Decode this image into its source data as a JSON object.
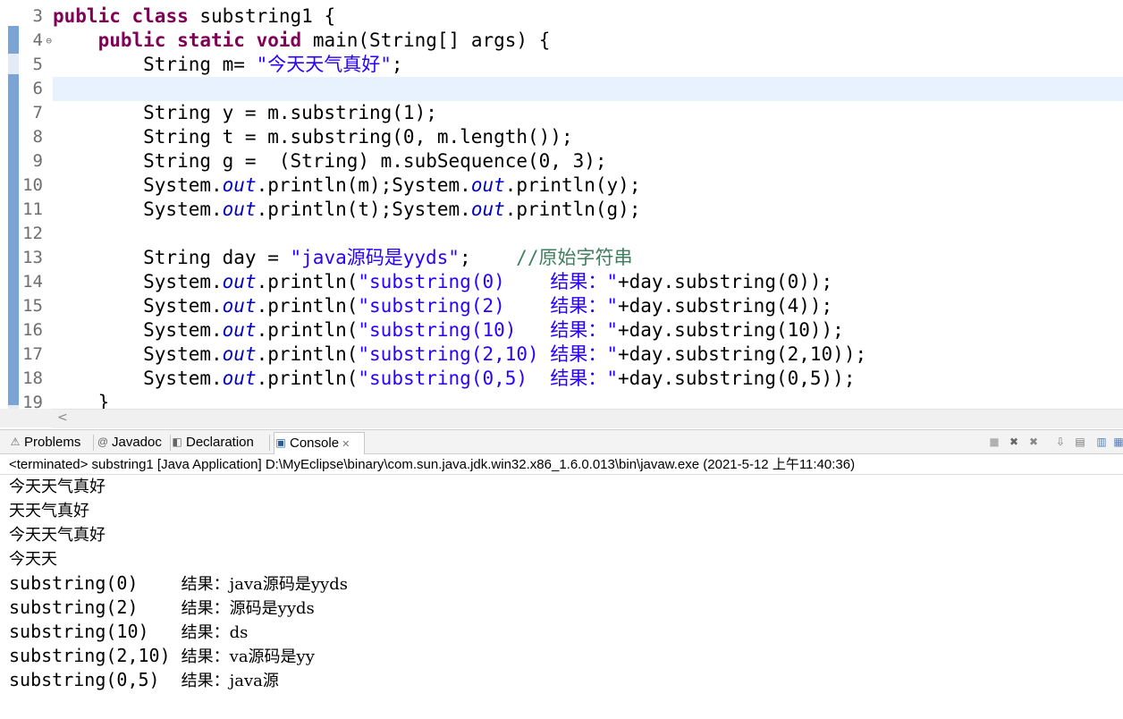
{
  "editor": {
    "line_numbers": [
      "3",
      "4",
      "5",
      "6",
      "7",
      "8",
      "9",
      "10",
      "11",
      "12",
      "13",
      "14",
      "15",
      "16",
      "17",
      "18",
      "19"
    ],
    "fold_marker": "⊖",
    "lines": [
      [
        {
          "t": "kw",
          "v": "public"
        },
        {
          "t": "p",
          "v": " "
        },
        {
          "t": "kw",
          "v": "class"
        },
        {
          "t": "p",
          "v": " substring1 {"
        }
      ],
      [
        {
          "t": "p",
          "v": "    "
        },
        {
          "t": "kw",
          "v": "public"
        },
        {
          "t": "p",
          "v": " "
        },
        {
          "t": "kw",
          "v": "static"
        },
        {
          "t": "p",
          "v": " "
        },
        {
          "t": "kw",
          "v": "void"
        },
        {
          "t": "p",
          "v": " main(String[] args) {"
        }
      ],
      [
        {
          "t": "p",
          "v": "        String m= "
        },
        {
          "t": "str",
          "v": "\"今天天气真好\""
        },
        {
          "t": "p",
          "v": ";"
        }
      ],
      [],
      [
        {
          "t": "p",
          "v": "        String y = m.substring(1);"
        }
      ],
      [
        {
          "t": "p",
          "v": "        String t = m.substring(0, m.length());"
        }
      ],
      [
        {
          "t": "p",
          "v": "        String g =  (String) m.subSequence(0, 3);"
        }
      ],
      [
        {
          "t": "p",
          "v": "        System."
        },
        {
          "t": "fld",
          "v": "out"
        },
        {
          "t": "p",
          "v": ".println(m);System."
        },
        {
          "t": "fld",
          "v": "out"
        },
        {
          "t": "p",
          "v": ".println(y);"
        }
      ],
      [
        {
          "t": "p",
          "v": "        System."
        },
        {
          "t": "fld",
          "v": "out"
        },
        {
          "t": "p",
          "v": ".println(t);System."
        },
        {
          "t": "fld",
          "v": "out"
        },
        {
          "t": "p",
          "v": ".println(g);"
        }
      ],
      [],
      [
        {
          "t": "p",
          "v": "        String day = "
        },
        {
          "t": "str",
          "v": "\"java源码是yyds\""
        },
        {
          "t": "p",
          "v": ";    "
        },
        {
          "t": "cmt",
          "v": "//原始字符串"
        }
      ],
      [
        {
          "t": "p",
          "v": "        System."
        },
        {
          "t": "fld",
          "v": "out"
        },
        {
          "t": "p",
          "v": ".println("
        },
        {
          "t": "str",
          "v": "\"substring(0)    结果：\""
        },
        {
          "t": "p",
          "v": "+day.substring(0));"
        }
      ],
      [
        {
          "t": "p",
          "v": "        System."
        },
        {
          "t": "fld",
          "v": "out"
        },
        {
          "t": "p",
          "v": ".println("
        },
        {
          "t": "str",
          "v": "\"substring(2)    结果：\""
        },
        {
          "t": "p",
          "v": "+day.substring(4));"
        }
      ],
      [
        {
          "t": "p",
          "v": "        System."
        },
        {
          "t": "fld",
          "v": "out"
        },
        {
          "t": "p",
          "v": ".println("
        },
        {
          "t": "str",
          "v": "\"substring(10)   结果：\""
        },
        {
          "t": "p",
          "v": "+day.substring(10));"
        }
      ],
      [
        {
          "t": "p",
          "v": "        System."
        },
        {
          "t": "fld",
          "v": "out"
        },
        {
          "t": "p",
          "v": ".println("
        },
        {
          "t": "str",
          "v": "\"substring(2,10) 结果：\""
        },
        {
          "t": "p",
          "v": "+day.substring(2,10));"
        }
      ],
      [
        {
          "t": "p",
          "v": "        System."
        },
        {
          "t": "fld",
          "v": "out"
        },
        {
          "t": "p",
          "v": ".println("
        },
        {
          "t": "str",
          "v": "\"substring(0,5)  结果：\""
        },
        {
          "t": "p",
          "v": "+day.substring(0,5));"
        }
      ],
      [
        {
          "t": "p",
          "v": "    }"
        }
      ]
    ],
    "current_line_index": 3,
    "scroll_left_arrow": "<"
  },
  "views": {
    "tabs": [
      {
        "label": "Problems",
        "icon": "problems-icon",
        "glyph": "⚠"
      },
      {
        "label": "Javadoc",
        "icon": "javadoc-icon",
        "glyph": "@"
      },
      {
        "label": "Declaration",
        "icon": "declaration-icon",
        "glyph": "◧"
      },
      {
        "label": "Console",
        "icon": "console-icon",
        "glyph": "▣"
      }
    ],
    "close_glyph": "✕",
    "toolbar": [
      {
        "name": "terminate-icon",
        "glyph": "■"
      },
      {
        "name": "remove-launch-icon",
        "glyph": "✖"
      },
      {
        "name": "remove-all-terminated-icon",
        "glyph": "✖"
      },
      {
        "name": "scroll-lock-icon",
        "glyph": "⇩"
      },
      {
        "name": "clear-console-icon",
        "glyph": "▤"
      },
      {
        "name": "pin-console-icon",
        "glyph": "▥"
      },
      {
        "name": "display-console-icon",
        "glyph": "▦"
      }
    ]
  },
  "console": {
    "header": "<terminated> substring1 [Java Application] D:\\MyEclipse\\binary\\com.sun.java.jdk.win32.x86_1.6.0.013\\bin\\javaw.exe (2021-5-12 上午11:40:36)",
    "output": [
      {
        "a": "",
        "b": "今天天气真好"
      },
      {
        "a": "",
        "b": "天天气真好"
      },
      {
        "a": "",
        "b": "今天天气真好"
      },
      {
        "a": "",
        "b": "今天天"
      },
      {
        "a": "substring(0)    ",
        "b": "结果：java源码是yyds"
      },
      {
        "a": "substring(2)    ",
        "b": "结果：源码是yyds"
      },
      {
        "a": "substring(10)   ",
        "b": "结果：ds"
      },
      {
        "a": "substring(2,10) ",
        "b": "结果：va源码是yy"
      },
      {
        "a": "substring(0,5)  ",
        "b": "结果：java源"
      }
    ]
  }
}
